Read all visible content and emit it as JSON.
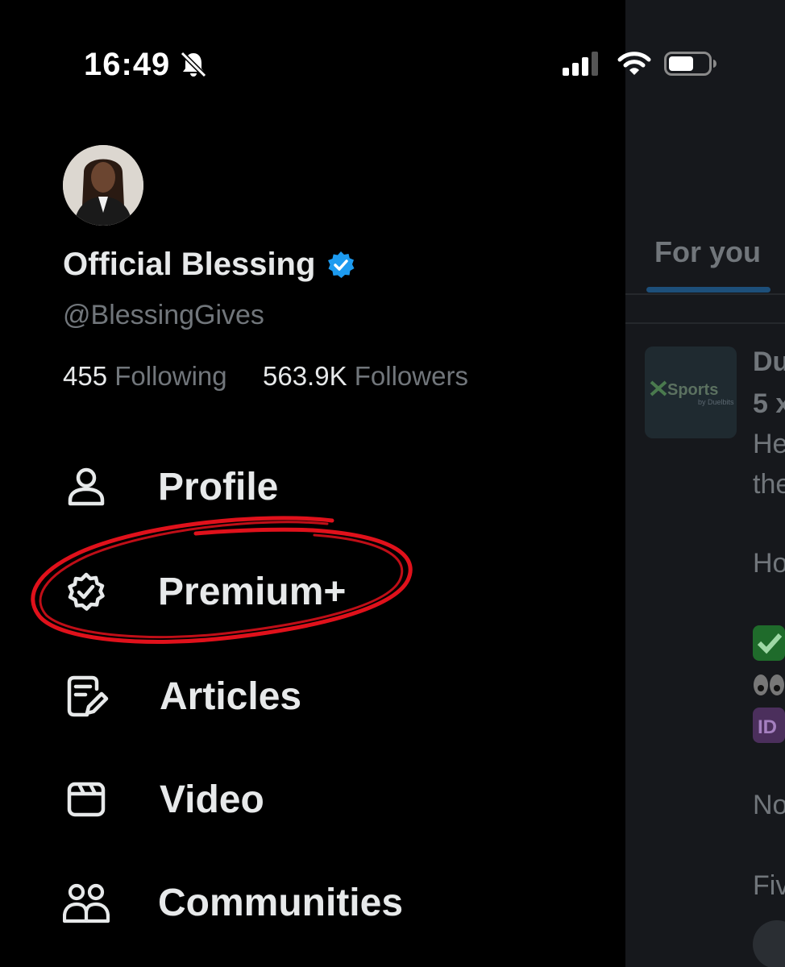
{
  "status_bar": {
    "time": "16:49",
    "icons": [
      "bell-slash-icon",
      "signal-icon",
      "wifi-icon",
      "battery-icon"
    ]
  },
  "profile": {
    "name": "Official Blessing",
    "handle": "@BlessingGives",
    "following_count": "455",
    "following_label": "Following",
    "followers_count": "563.9K",
    "followers_label": "Followers",
    "verified_color": "#1d9bf0"
  },
  "menu": [
    {
      "label": "Profile",
      "icon": "person-icon"
    },
    {
      "label": "Premium+",
      "icon": "verified-badge-icon"
    },
    {
      "label": "Articles",
      "icon": "article-edit-icon"
    },
    {
      "label": "Video",
      "icon": "video-clapper-icon"
    },
    {
      "label": "Communities",
      "icon": "communities-icon"
    }
  ],
  "annotation_color": "#e0111b",
  "background_feed": {
    "tab_label": "For you",
    "card_label": "Sports",
    "card_sub": "by Duelbits",
    "fragments": [
      "Du",
      "5 x",
      "He",
      "the",
      "Ho",
      "No",
      "Fiv"
    ]
  }
}
